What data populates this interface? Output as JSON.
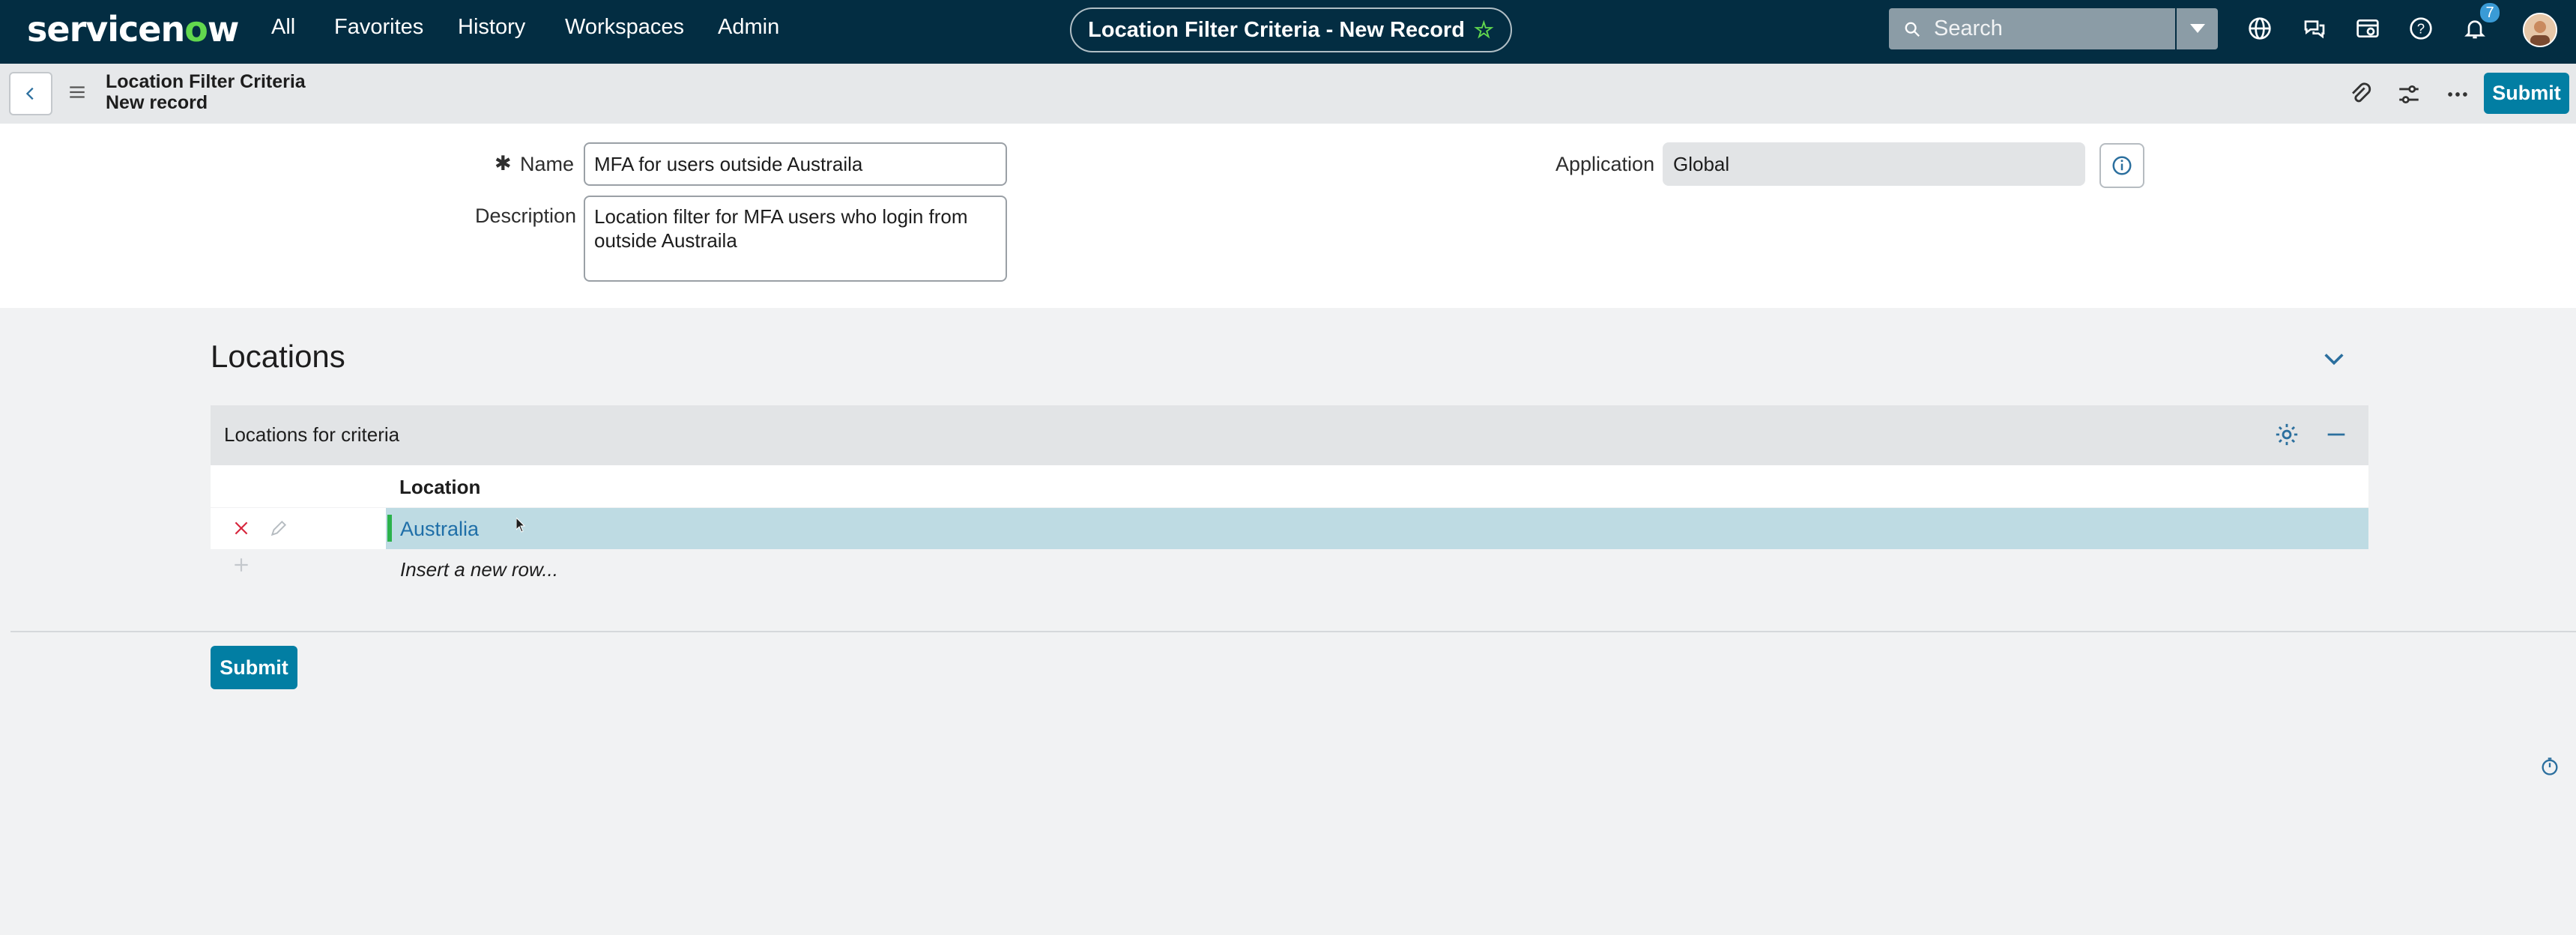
{
  "brand": {
    "logo_text_a": "servicen",
    "logo_text_o": "o",
    "logo_text_b": "w"
  },
  "nav": {
    "items": [
      "All",
      "Favorites",
      "History",
      "Workspaces",
      "Admin"
    ]
  },
  "header": {
    "title": "Location Filter Criteria - New Record"
  },
  "search": {
    "placeholder": "Search"
  },
  "notifications": {
    "count": "7"
  },
  "record": {
    "table_label": "Location Filter Criteria",
    "subtitle": "New record",
    "submit_label": "Submit"
  },
  "form": {
    "name_required_mark": "✱",
    "name_label": "Name",
    "name_value": "MFA for users outside Austraila",
    "description_label": "Description",
    "description_value": "Location filter for MFA users who login from outside Austraila",
    "application_label": "Application",
    "application_value": "Global"
  },
  "related": {
    "section_title": "Locations",
    "list_title": "Locations for criteria",
    "column_header": "Location",
    "rows": [
      {
        "location": "Australia"
      }
    ],
    "insert_row_label": "Insert a new row..."
  },
  "footer": {
    "submit_label": "Submit"
  },
  "colors": {
    "nav_bg": "#032d42",
    "accent": "#027ea3",
    "brand_green": "#62d84e",
    "selected_row": "#bedbe3"
  }
}
